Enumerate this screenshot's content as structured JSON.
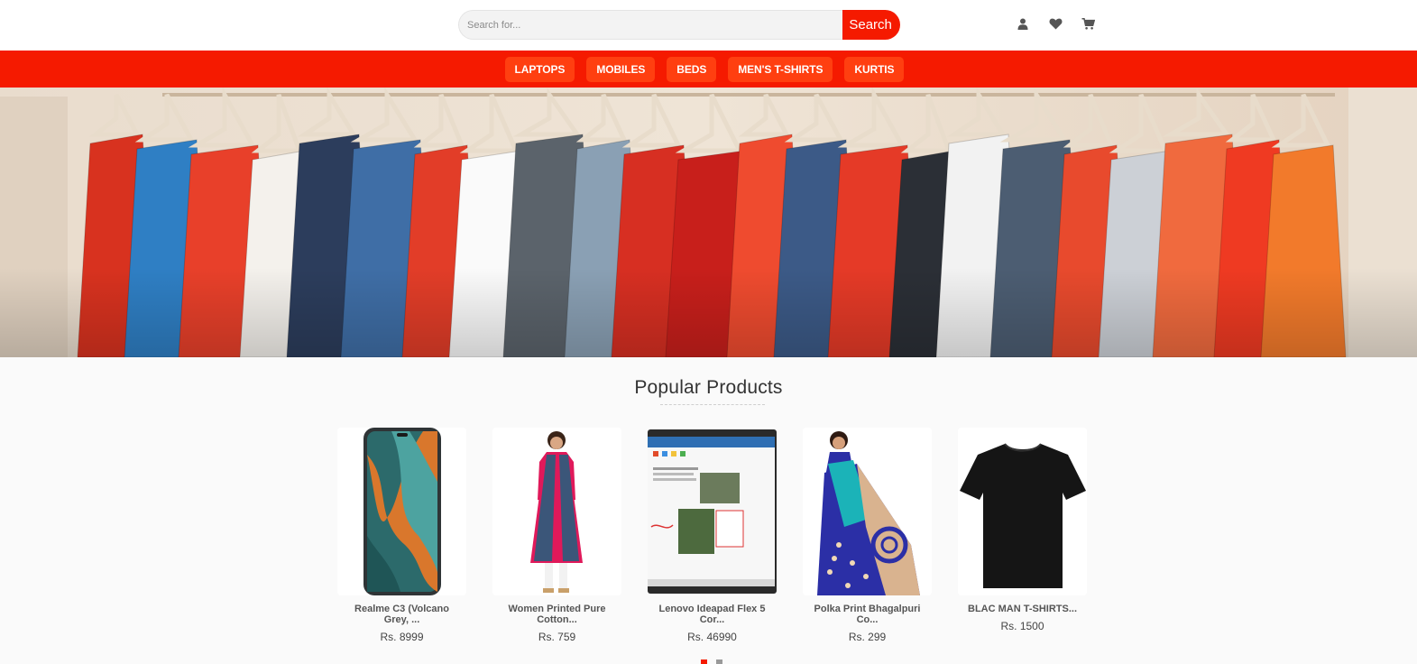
{
  "search": {
    "placeholder": "Search for...",
    "button_label": "Search"
  },
  "header_icons": [
    "user-icon",
    "heart-icon",
    "cart-icon"
  ],
  "nav": {
    "items": [
      {
        "label": "LAPTOPS"
      },
      {
        "label": "MOBILES"
      },
      {
        "label": "BEDS"
      },
      {
        "label": "MEN'S T-SHIRTS"
      },
      {
        "label": "KURTIS"
      }
    ]
  },
  "banner": {
    "image": "clothes-rack-banner"
  },
  "popular": {
    "title": "Popular Products",
    "products": [
      {
        "name": "Realme C3 (Volcano Grey, ...",
        "price": "Rs. 8999",
        "image": "phone"
      },
      {
        "name": "Women Printed Pure Cotton...",
        "price": "Rs. 759",
        "image": "kurti"
      },
      {
        "name": "Lenovo Ideapad Flex 5 Cor...",
        "price": "Rs. 46990",
        "image": "laptop"
      },
      {
        "name": "Polka Print Bhagalpuri Co...",
        "price": "Rs. 299",
        "image": "saree"
      },
      {
        "name": "BLAC MAN T-SHIRTS...",
        "price": "Rs. 1500",
        "image": "tshirt"
      }
    ]
  },
  "carousel": {
    "pages": 2,
    "active_page": 1
  },
  "colors": {
    "brand": "#f51a00",
    "nav_item": "#ff3f10",
    "background": "#fafafa"
  }
}
